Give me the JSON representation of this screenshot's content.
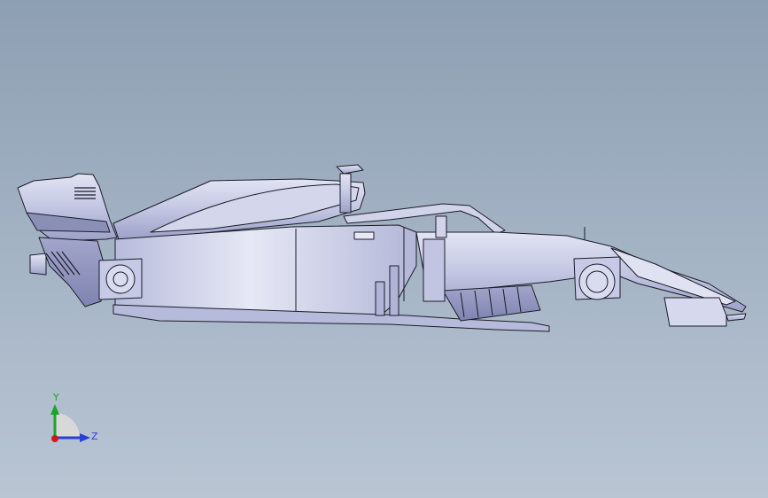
{
  "viewport": {
    "background_top": "#8d9fb3",
    "background_bottom": "#b9c5d3"
  },
  "model": {
    "name_icon": "formula-car-side-view",
    "body_color": "#c9cde6",
    "shade_color": "#9ea3c9",
    "edge_color": "#1c1c28"
  },
  "triad": {
    "y_label": "Y",
    "z_label": "Z",
    "y_color": "#1aa52a",
    "z_color": "#2a3fd6",
    "origin_color": "#d01a1a"
  }
}
